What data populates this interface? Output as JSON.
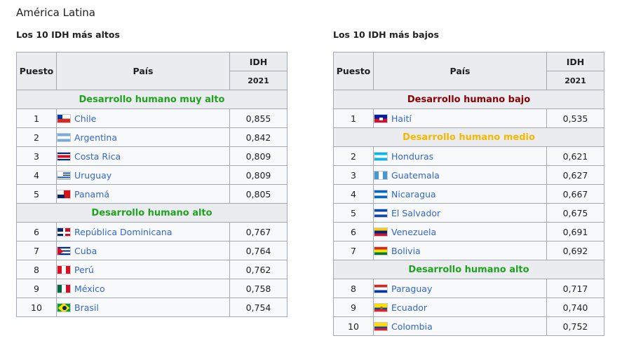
{
  "page_title": "América Latina",
  "headers": {
    "rank": "Puesto",
    "country": "País",
    "idh": "IDH",
    "year": "2021"
  },
  "left": {
    "title": "Los 10 IDH más altos",
    "cat_very_high": "Desarrollo humano muy alto",
    "cat_high": "Desarrollo humano alto",
    "rows": [
      {
        "rank": "1",
        "country": "Chile",
        "flag": "flag-chile",
        "idh": "0,855"
      },
      {
        "rank": "2",
        "country": "Argentina",
        "flag": "flag-argentina",
        "idh": "0,842"
      },
      {
        "rank": "3",
        "country": "Costa Rica",
        "flag": "flag-costarica",
        "idh": "0,809"
      },
      {
        "rank": "4",
        "country": "Uruguay",
        "flag": "flag-uruguay",
        "idh": "0,809"
      },
      {
        "rank": "5",
        "country": "Panamá",
        "flag": "flag-panama",
        "idh": "0,805"
      },
      {
        "rank": "6",
        "country": "República Dominicana",
        "flag": "flag-dominicana",
        "idh": "0,767"
      },
      {
        "rank": "7",
        "country": "Cuba",
        "flag": "flag-cuba",
        "idh": "0,764"
      },
      {
        "rank": "8",
        "country": "Perú",
        "flag": "flag-peru",
        "idh": "0,762"
      },
      {
        "rank": "9",
        "country": "México",
        "flag": "flag-mexico",
        "idh": "0,758"
      },
      {
        "rank": "10",
        "country": "Brasil",
        "flag": "flag-brasil",
        "idh": "0,754"
      }
    ]
  },
  "right": {
    "title": "Los 10 IDH más bajos",
    "cat_low": "Desarrollo humano bajo",
    "cat_medium": "Desarrollo humano medio",
    "cat_high": "Desarrollo humano alto",
    "rows": [
      {
        "rank": "1",
        "country": "Haití",
        "flag": "flag-haiti",
        "idh": "0,535"
      },
      {
        "rank": "2",
        "country": "Honduras",
        "flag": "flag-honduras",
        "idh": "0,621"
      },
      {
        "rank": "3",
        "country": "Guatemala",
        "flag": "flag-guatemala",
        "idh": "0,627"
      },
      {
        "rank": "4",
        "country": "Nicaragua",
        "flag": "flag-nicaragua",
        "idh": "0,667"
      },
      {
        "rank": "5",
        "country": "El Salvador",
        "flag": "flag-elsalvador",
        "idh": "0,675"
      },
      {
        "rank": "6",
        "country": "Venezuela",
        "flag": "flag-venezuela",
        "idh": "0,691"
      },
      {
        "rank": "7",
        "country": "Bolivia",
        "flag": "flag-bolivia",
        "idh": "0,692"
      },
      {
        "rank": "8",
        "country": "Paraguay",
        "flag": "flag-paraguay",
        "idh": "0,717"
      },
      {
        "rank": "9",
        "country": "Ecuador",
        "flag": "flag-ecuador",
        "idh": "0,740"
      },
      {
        "rank": "10",
        "country": "Colombia",
        "flag": "flag-colombia",
        "idh": "0,752"
      }
    ]
  }
}
